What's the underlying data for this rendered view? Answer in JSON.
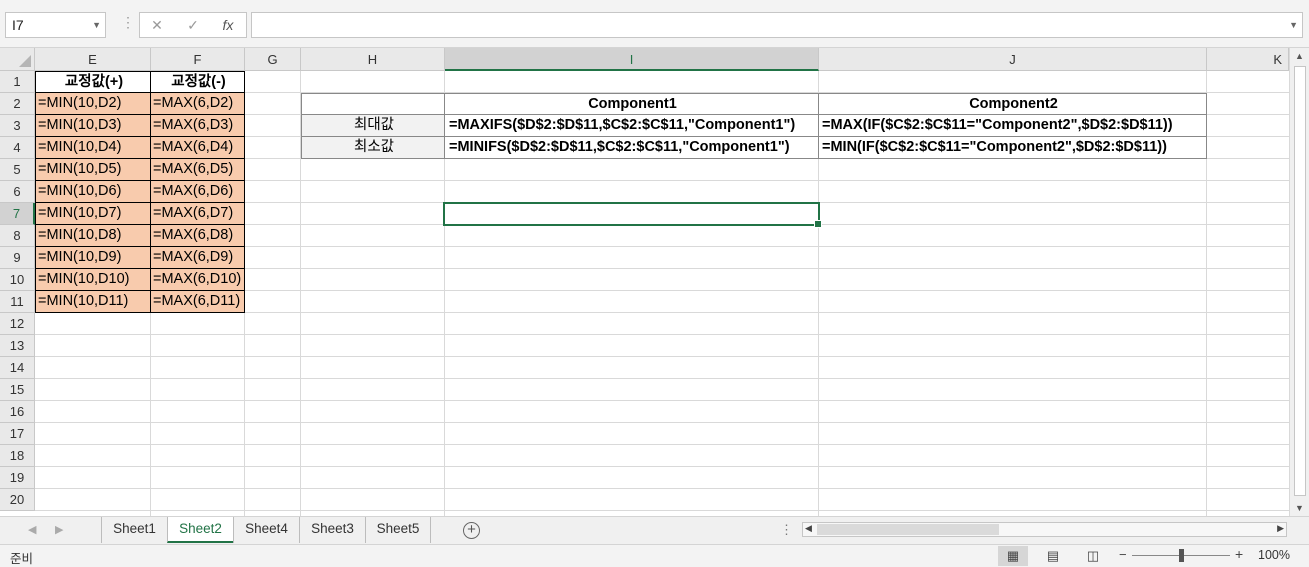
{
  "formula_bar": {
    "name_box": "I7",
    "cancel_icon": "✕",
    "enter_icon": "✓",
    "fx_icon": "fx",
    "formula": ""
  },
  "columns": [
    "E",
    "F",
    "G",
    "H",
    "I",
    "J",
    "K"
  ],
  "rows": [
    "1",
    "2",
    "3",
    "4",
    "5",
    "6",
    "7",
    "8",
    "9",
    "10",
    "11",
    "12",
    "13",
    "14",
    "15",
    "16",
    "17",
    "18",
    "19",
    "20"
  ],
  "fixed_values": {
    "e_header": "교정값(+)",
    "f_header": "교정값(-)",
    "e_cells": [
      "=MIN(10,D2)",
      "=MIN(10,D3)",
      "=MIN(10,D4)",
      "=MIN(10,D5)",
      "=MIN(10,D6)",
      "=MIN(10,D7)",
      "=MIN(10,D8)",
      "=MIN(10,D9)",
      "=MIN(10,D10)",
      "=MIN(10,D11)"
    ],
    "f_cells": [
      "=MAX(6,D2)",
      "=MAX(6,D3)",
      "=MAX(6,D4)",
      "=MAX(6,D5)",
      "=MAX(6,D6)",
      "=MAX(6,D7)",
      "=MAX(6,D8)",
      "=MAX(6,D9)",
      "=MAX(6,D10)",
      "=MAX(6,D11)"
    ]
  },
  "summary_table": {
    "col_i_header": "Component1",
    "col_j_header": "Component2",
    "max_label": "최대값",
    "min_label": "최소값",
    "max_comp1": "=MAXIFS($D$2:$D$11,$C$2:$C$11,\"Component1\")",
    "max_comp2": "=MAX(IF($C$2:$C$11=\"Component2\",$D$2:$D$11))",
    "min_comp1": "=MINIFS($D$2:$D$11,$C$2:$C$11,\"Component1\")",
    "min_comp2": "=MIN(IF($C$2:$C$11=\"Component2\",$D$2:$D$11))"
  },
  "sheet_tabs": [
    "Sheet1",
    "Sheet2",
    "Sheet4",
    "Sheet3",
    "Sheet5"
  ],
  "active_sheet": "Sheet2",
  "status": {
    "ready": "준비",
    "zoom": "100%"
  },
  "colors": {
    "accent": "#217346",
    "fixed_fill": "#f8cbad"
  }
}
